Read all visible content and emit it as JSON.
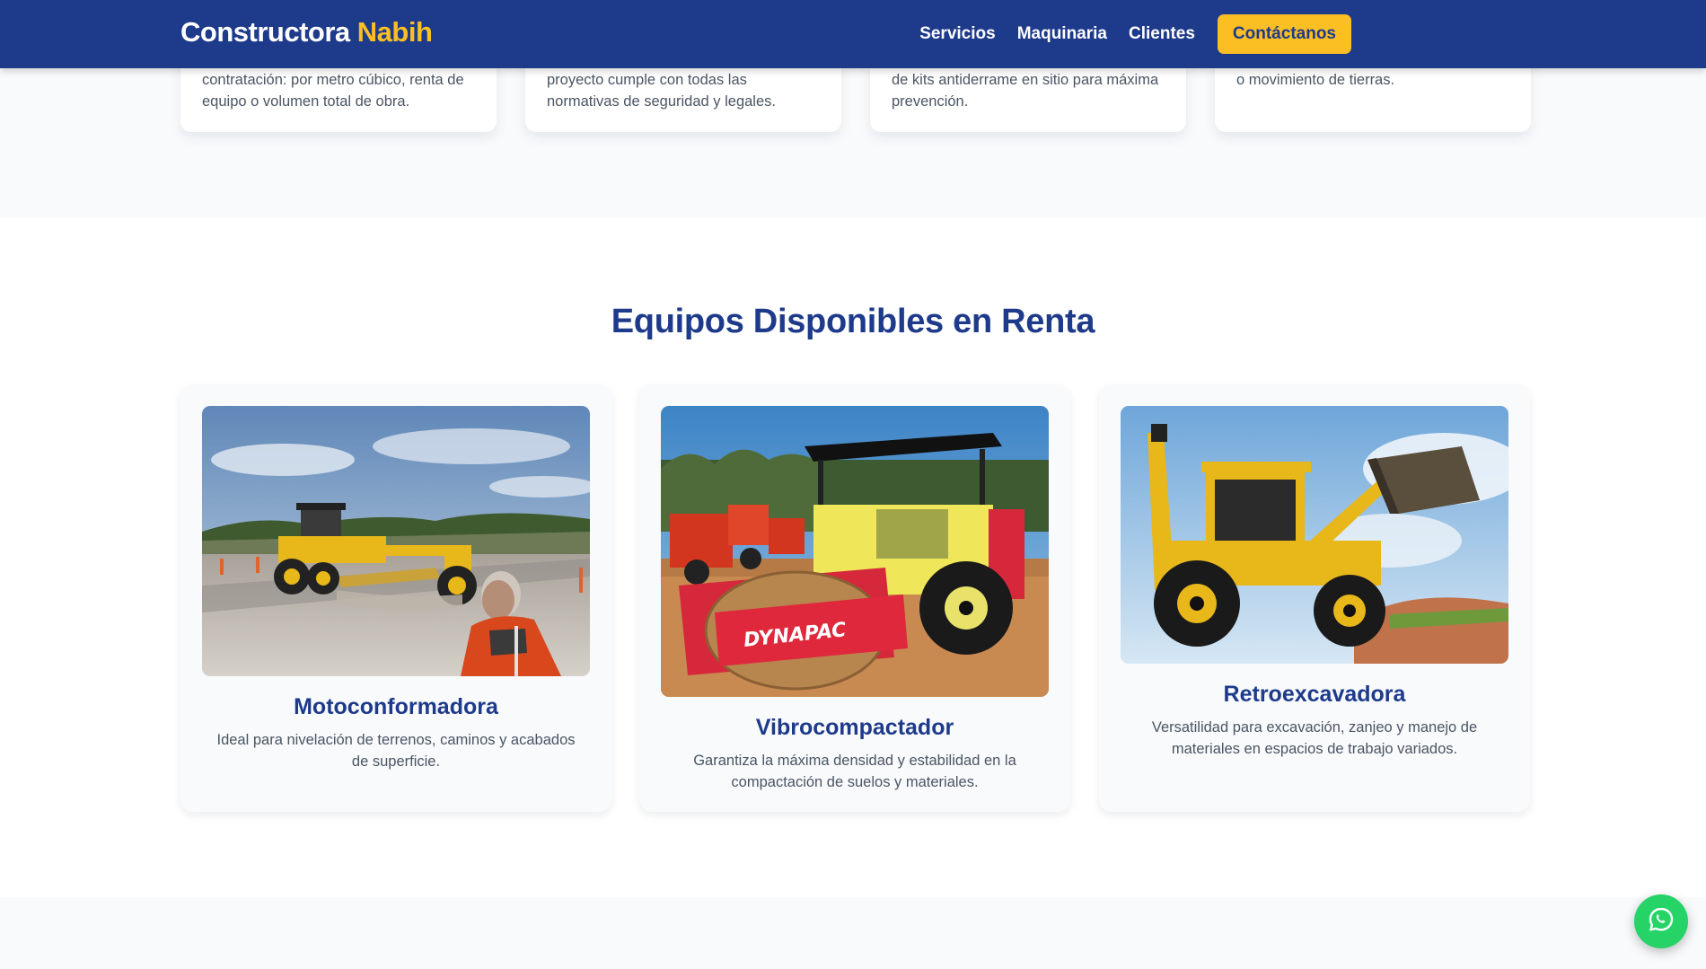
{
  "header": {
    "logo_main": "Constructora",
    "logo_accent": "Nabih",
    "nav": [
      "Servicios",
      "Maquinaria",
      "Clientes"
    ],
    "cta_label": "Contáctanos"
  },
  "services": {
    "cards": [
      {
        "text": "contratación: por metro cúbico, renta de equipo o volumen total de obra."
      },
      {
        "text": "proyecto cumple con todas las normativas de seguridad y legales."
      },
      {
        "text": "de kits antiderrame en sitio para máxima prevención."
      },
      {
        "text": "o movimiento de tierras."
      }
    ]
  },
  "equipment": {
    "title": "Equipos Disponibles en Renta",
    "items": [
      {
        "name": "Motoconformadora",
        "description": "Ideal para nivelación de terrenos, caminos y acabados de superficie.",
        "image_label": "motor grader photo"
      },
      {
        "name": "Vibrocompactador",
        "description": "Garantiza la máxima densidad y estabilidad en la compactación de suelos y materiales.",
        "image_label": "vibratory roller photo",
        "brand_text": "DYNAPAC"
      },
      {
        "name": "Retroexcavadora",
        "description": "Versatilidad para excavación, zanjeo y manejo de materiales en espacios de trabajo variados.",
        "image_label": "backhoe loader photo"
      }
    ]
  },
  "fab": {
    "icon": "whatsapp-icon"
  },
  "colors": {
    "primary": "#1e3a8a",
    "accent": "#fbbf24",
    "whatsapp": "#25d366",
    "section_bg": "#f8fafc"
  }
}
